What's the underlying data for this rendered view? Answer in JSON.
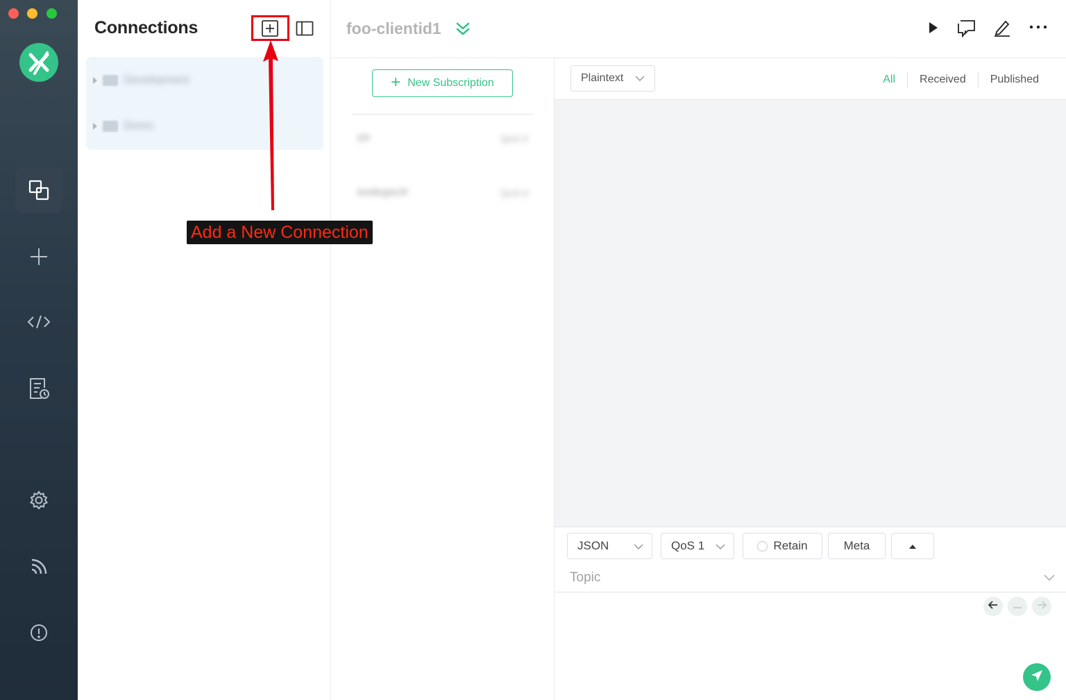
{
  "window": {
    "traffic_lights": [
      "close",
      "minimize",
      "zoom"
    ]
  },
  "sidebar": {
    "logo": "mqttx-logo",
    "items": [
      {
        "name": "connections",
        "icon": "connections-icon",
        "active": true
      },
      {
        "name": "new-connection",
        "icon": "plus-icon",
        "active": false
      },
      {
        "name": "script",
        "icon": "code-icon",
        "active": false
      },
      {
        "name": "log",
        "icon": "log-icon",
        "active": false
      },
      {
        "name": "settings",
        "icon": "gear-icon",
        "active": false
      },
      {
        "name": "help",
        "icon": "rss-icon",
        "active": false
      },
      {
        "name": "about",
        "icon": "info-icon",
        "active": false
      }
    ]
  },
  "connections_panel": {
    "title": "Connections",
    "tree": [
      {
        "label": "Development",
        "blurred": true
      },
      {
        "label": "Demo",
        "blurred": true
      }
    ]
  },
  "annotation": {
    "text": "Add a New Connection",
    "color": "#ff2a12"
  },
  "header": {
    "connection_name": "foo-clientid1"
  },
  "subscriptions": {
    "new_button_label": "New Subscription",
    "items": [
      {
        "topic": "t/#",
        "qos": "QoS 0"
      },
      {
        "topic": "testtopic/#",
        "qos": "QoS 0"
      }
    ]
  },
  "messages": {
    "payload_type": "Plaintext",
    "filters": [
      "All",
      "Received",
      "Published"
    ],
    "active_filter": "All"
  },
  "publish": {
    "format": "JSON",
    "qos": "QoS 1",
    "retain_label": "Retain",
    "meta_label": "Meta",
    "topic_placeholder": "Topic"
  },
  "colors": {
    "accent": "#34c388",
    "sidebar_bg": "#2a3947",
    "highlight": "#e60012"
  }
}
